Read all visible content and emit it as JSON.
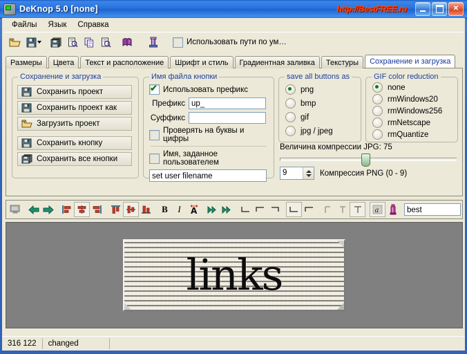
{
  "window": {
    "title": "DeKnop 5.0 [none]",
    "watermark": "http://BestFREE.ru",
    "icon": "app-icon",
    "buttons": {
      "minimize": "_",
      "maximize": "□",
      "close": "✕"
    }
  },
  "menu": {
    "items": [
      "Файлы",
      "Язык",
      "Справка"
    ]
  },
  "toolbar_main": {
    "icons": [
      "open-folder-icon",
      "save-floppy-icon",
      "save-dropdown-caret",
      "save-all-icon",
      "preview-icon",
      "copy-icon",
      "find-icon",
      "book-help-icon",
      "column-icon"
    ],
    "default_paths": {
      "label": "Использовать пути по ум…",
      "checked": false
    }
  },
  "tabs": {
    "items": [
      "Размеры",
      "Цвета",
      "Текст и расположение",
      "Шрифт и стиль",
      "Градиентная заливка",
      "Текстуры",
      "Сохранение и загрузка"
    ],
    "active_index": 6
  },
  "save_load_group": {
    "legend": "Сохранение и загрузка",
    "buttons": [
      {
        "label": "Сохранить проект",
        "icon": "save-floppy-icon"
      },
      {
        "label": "Сохранить проект как",
        "icon": "save-floppy-icon"
      },
      {
        "label": "Загрузить проект",
        "icon": "open-folder-icon"
      },
      {
        "label": "Сохранить кнопку",
        "icon": "save-floppy-icon"
      },
      {
        "label": "Сохранить все кнопки",
        "icon": "save-all-icon"
      }
    ]
  },
  "filename_group": {
    "legend": "Имя файла кнопки",
    "use_prefix": {
      "label": "Использовать префикс",
      "checked": true
    },
    "prefix": {
      "label": "Префикс",
      "value": "up_"
    },
    "suffix": {
      "label": "Суффикс",
      "value": ""
    },
    "check_alnum": {
      "label": "Проверять на буквы и цифры",
      "checked": false
    },
    "user_defined": {
      "label": "Имя, заданное пользователем",
      "checked": false
    },
    "user_filename": {
      "value": "set user filename"
    }
  },
  "save_as_group": {
    "legend": "save all buttons as",
    "options": [
      "png",
      "bmp",
      "gif",
      "jpg / jpeg"
    ],
    "selected": "png"
  },
  "gif_group": {
    "legend": "GIF color reduction",
    "options": [
      "none",
      "rmWindows20",
      "rmWindows256",
      "rmNetscape",
      "rmQuantize"
    ],
    "selected": "none"
  },
  "compression": {
    "jpg_label": "Величина компрессии JPG: 75",
    "jpg_value": 75,
    "jpg_percent": 46,
    "png_value": "9",
    "png_label": "Компрессия PNG (0 - 9)"
  },
  "toolbar_edit": {
    "icons": [
      "monitor-icon",
      "arrow-left-icon",
      "arrow-right-icon",
      "align-left-icon",
      "align-center-icon",
      "align-right-icon",
      "align-top-icon",
      "align-middle-icon",
      "align-bottom-icon",
      "bold-icon",
      "italic-icon",
      "text-size-icon",
      "double-arrow-right-icon",
      "double-arrow-right2-icon",
      "corner-bl-icon",
      "corner-tl-icon",
      "corner-tr-icon",
      "corner-bl2-icon",
      "corner-tl2-icon",
      "text-left-icon",
      "text-center-icon",
      "text-right-icon",
      "texture-a-icon",
      "color-picker-icon"
    ],
    "text_value": "best"
  },
  "preview": {
    "text": "links"
  },
  "statusbar": {
    "coords": "316 122",
    "state": "changed"
  },
  "colors": {
    "title_blue": "#2f62bb",
    "watermark_red": "#ff3b10",
    "group_legend": "#20409a",
    "face": "#ece9d8",
    "canvas_gray": "#808080"
  }
}
